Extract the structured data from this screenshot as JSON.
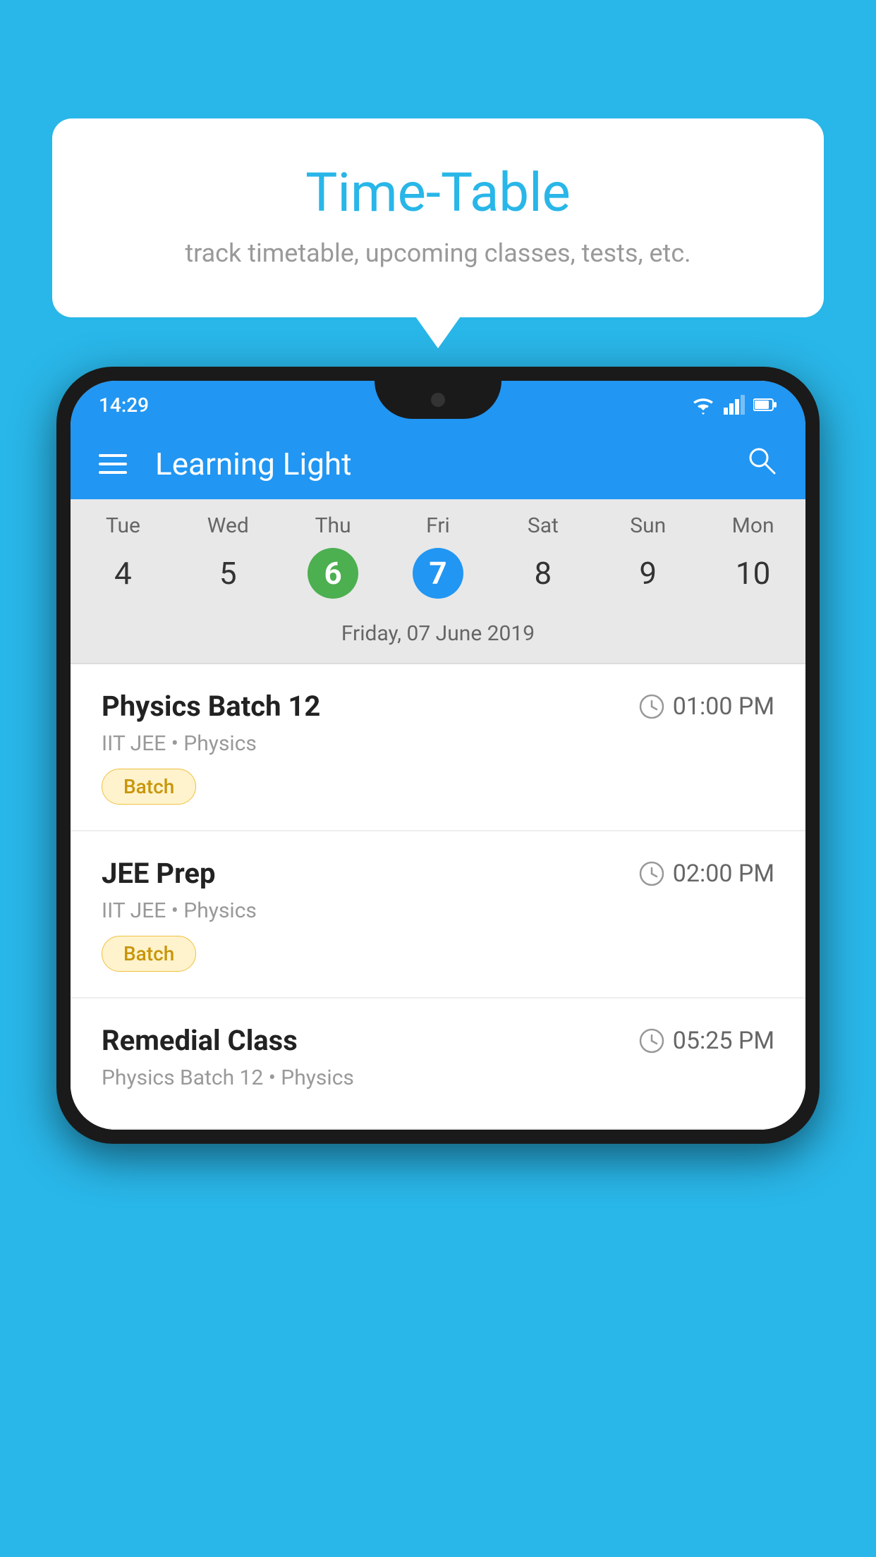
{
  "background_color": "#29B6E8",
  "tooltip": {
    "title": "Time-Table",
    "subtitle": "track timetable, upcoming classes, tests, etc."
  },
  "phone": {
    "status_bar": {
      "time": "14:29",
      "wifi_icon": "wifi",
      "signal_icon": "signal",
      "battery_icon": "battery"
    },
    "app_header": {
      "title": "Learning Light",
      "menu_label": "Menu",
      "search_label": "Search"
    },
    "calendar": {
      "days": [
        {
          "name": "Tue",
          "num": "4",
          "state": "normal"
        },
        {
          "name": "Wed",
          "num": "5",
          "state": "normal"
        },
        {
          "name": "Thu",
          "num": "6",
          "state": "today"
        },
        {
          "name": "Fri",
          "num": "7",
          "state": "selected"
        },
        {
          "name": "Sat",
          "num": "8",
          "state": "normal"
        },
        {
          "name": "Sun",
          "num": "9",
          "state": "normal"
        },
        {
          "name": "Mon",
          "num": "10",
          "state": "normal"
        }
      ],
      "selected_date_label": "Friday, 07 June 2019"
    },
    "schedule": [
      {
        "title": "Physics Batch 12",
        "time": "01:00 PM",
        "meta": "IIT JEE • Physics",
        "tag": "Batch"
      },
      {
        "title": "JEE Prep",
        "time": "02:00 PM",
        "meta": "IIT JEE • Physics",
        "tag": "Batch"
      },
      {
        "title": "Remedial Class",
        "time": "05:25 PM",
        "meta": "Physics Batch 12 • Physics",
        "tag": null
      }
    ]
  }
}
